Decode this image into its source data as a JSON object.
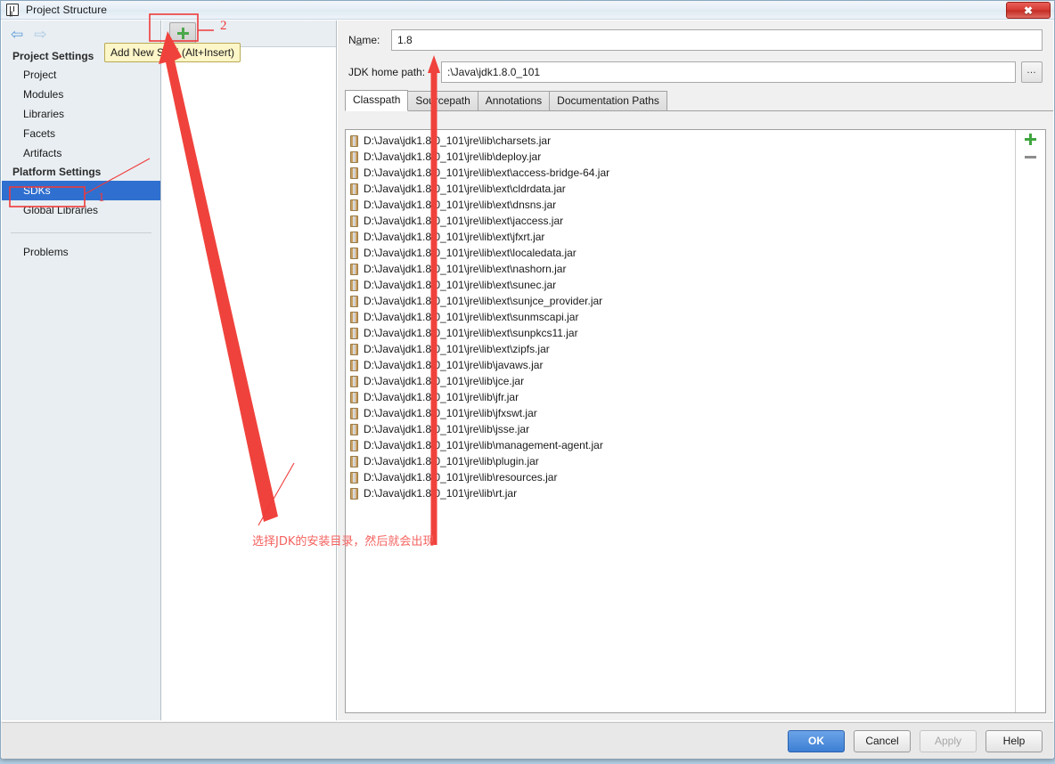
{
  "window": {
    "title": "Project Structure",
    "app_icon": "intellij-idea-icon",
    "close_label": "✖"
  },
  "nav": {
    "back_icon": "arrow-left-icon",
    "forward_icon": "arrow-right-icon"
  },
  "sidebar": {
    "groups": [
      {
        "header": "Project Settings",
        "items": [
          {
            "label": "Project",
            "selected": false
          },
          {
            "label": "Modules",
            "selected": false
          },
          {
            "label": "Libraries",
            "selected": false
          },
          {
            "label": "Facets",
            "selected": false
          },
          {
            "label": "Artifacts",
            "selected": false
          }
        ]
      },
      {
        "header": "Platform Settings",
        "items": [
          {
            "label": "SDKs",
            "selected": true
          },
          {
            "label": "Global Libraries",
            "selected": false
          }
        ]
      }
    ],
    "problems_label": "Problems"
  },
  "sdk_toolbar": {
    "add_icon": "plus-icon",
    "tooltip": "Add New SDK (Alt+Insert)"
  },
  "details": {
    "name_label": "Na̲me:",
    "name_value": "1.8",
    "jdk_home_label": "JDK home path:",
    "jdk_home_value": ":\\Java\\jdk1.8.0_101",
    "browse_label": "…",
    "browse_icon": "ellipsis-icon",
    "tabs": [
      {
        "label": "Classpath",
        "active": true
      },
      {
        "label": "Sourcepath",
        "active": false
      },
      {
        "label": "Annotations",
        "active": false
      },
      {
        "label": "Documentation Paths",
        "active": false
      }
    ],
    "list_add_icon": "plus-icon",
    "list_remove_icon": "minus-icon",
    "classpath_entries": [
      "D:\\Java\\jdk1.8.0_101\\jre\\lib\\charsets.jar",
      "D:\\Java\\jdk1.8.0_101\\jre\\lib\\deploy.jar",
      "D:\\Java\\jdk1.8.0_101\\jre\\lib\\ext\\access-bridge-64.jar",
      "D:\\Java\\jdk1.8.0_101\\jre\\lib\\ext\\cldrdata.jar",
      "D:\\Java\\jdk1.8.0_101\\jre\\lib\\ext\\dnsns.jar",
      "D:\\Java\\jdk1.8.0_101\\jre\\lib\\ext\\jaccess.jar",
      "D:\\Java\\jdk1.8.0_101\\jre\\lib\\ext\\jfxrt.jar",
      "D:\\Java\\jdk1.8.0_101\\jre\\lib\\ext\\localedata.jar",
      "D:\\Java\\jdk1.8.0_101\\jre\\lib\\ext\\nashorn.jar",
      "D:\\Java\\jdk1.8.0_101\\jre\\lib\\ext\\sunec.jar",
      "D:\\Java\\jdk1.8.0_101\\jre\\lib\\ext\\sunjce_provider.jar",
      "D:\\Java\\jdk1.8.0_101\\jre\\lib\\ext\\sunmscapi.jar",
      "D:\\Java\\jdk1.8.0_101\\jre\\lib\\ext\\sunpkcs11.jar",
      "D:\\Java\\jdk1.8.0_101\\jre\\lib\\ext\\zipfs.jar",
      "D:\\Java\\jdk1.8.0_101\\jre\\lib\\javaws.jar",
      "D:\\Java\\jdk1.8.0_101\\jre\\lib\\jce.jar",
      "D:\\Java\\jdk1.8.0_101\\jre\\lib\\jfr.jar",
      "D:\\Java\\jdk1.8.0_101\\jre\\lib\\jfxswt.jar",
      "D:\\Java\\jdk1.8.0_101\\jre\\lib\\jsse.jar",
      "D:\\Java\\jdk1.8.0_101\\jre\\lib\\management-agent.jar",
      "D:\\Java\\jdk1.8.0_101\\jre\\lib\\plugin.jar",
      "D:\\Java\\jdk1.8.0_101\\jre\\lib\\resources.jar",
      "D:\\Java\\jdk1.8.0_101\\jre\\lib\\rt.jar"
    ]
  },
  "footer": {
    "ok": "OK",
    "cancel": "Cancel",
    "apply": "Apply",
    "help": "Help"
  },
  "annotations": {
    "color": "#ef3a3a",
    "text_color": "#f4625f",
    "marker_1": "1",
    "marker_2": "2",
    "note_cn": "选择JDK的安装目录，然后就会出现"
  }
}
